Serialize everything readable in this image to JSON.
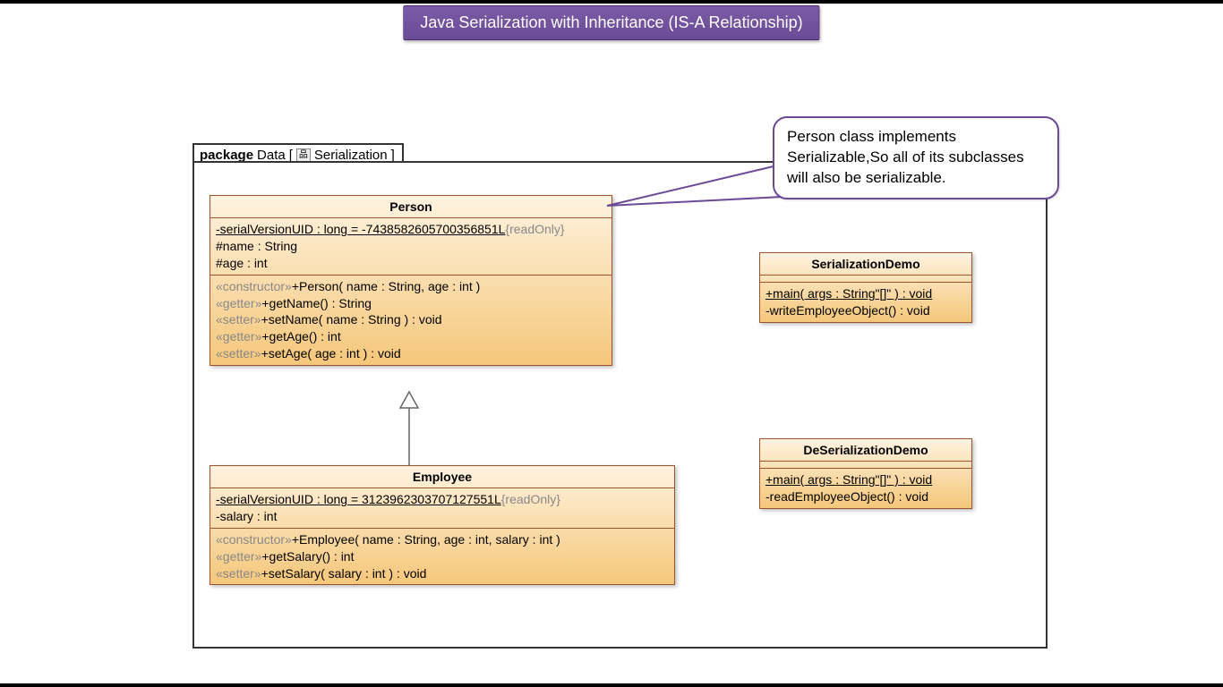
{
  "title": "Java Serialization with Inheritance (IS-A Relationship)",
  "package": {
    "label": "package",
    "name": "Data",
    "bracket_open": "[",
    "bracket_close": "]",
    "sub": "Serialization"
  },
  "callout": {
    "text": "Person class implements Serializable,So all of its subclasses will also be serializable."
  },
  "person": {
    "name": "Person",
    "attr1": "-serialVersionUID : long = -7438582605700356851L",
    "attr1_constraint": "{readOnly}",
    "attr2": "#name : String",
    "attr3": "#age : int",
    "op1_stereo": "«constructor»",
    "op1": "+Person( name : String, age : int )",
    "op2_stereo": "«getter»",
    "op2": "+getName() : String",
    "op3_stereo": "«setter»",
    "op3": "+setName( name : String ) : void",
    "op4_stereo": "«getter»",
    "op4": "+getAge() : int",
    "op5_stereo": "«setter»",
    "op5": "+setAge( age : int ) : void"
  },
  "employee": {
    "name": "Employee",
    "attr1": "-serialVersionUID : long = 3123962303707127551L",
    "attr1_constraint": "{readOnly}",
    "attr2": "-salary : int",
    "op1_stereo": "«constructor»",
    "op1": "+Employee( name : String, age : int, salary : int )",
    "op2_stereo": "«getter»",
    "op2": "+getSalary() : int",
    "op3_stereo": "«setter»",
    "op3": "+setSalary( salary : int ) : void"
  },
  "serdemo": {
    "name": "SerializationDemo",
    "op1": "+main( args : String\"[]\" ) : void",
    "op2": "-writeEmployeeObject() : void"
  },
  "deserdemo": {
    "name": "DeSerializationDemo",
    "op1": "+main( args : String\"[]\" ) : void",
    "op2": "-readEmployeeObject() : void"
  }
}
